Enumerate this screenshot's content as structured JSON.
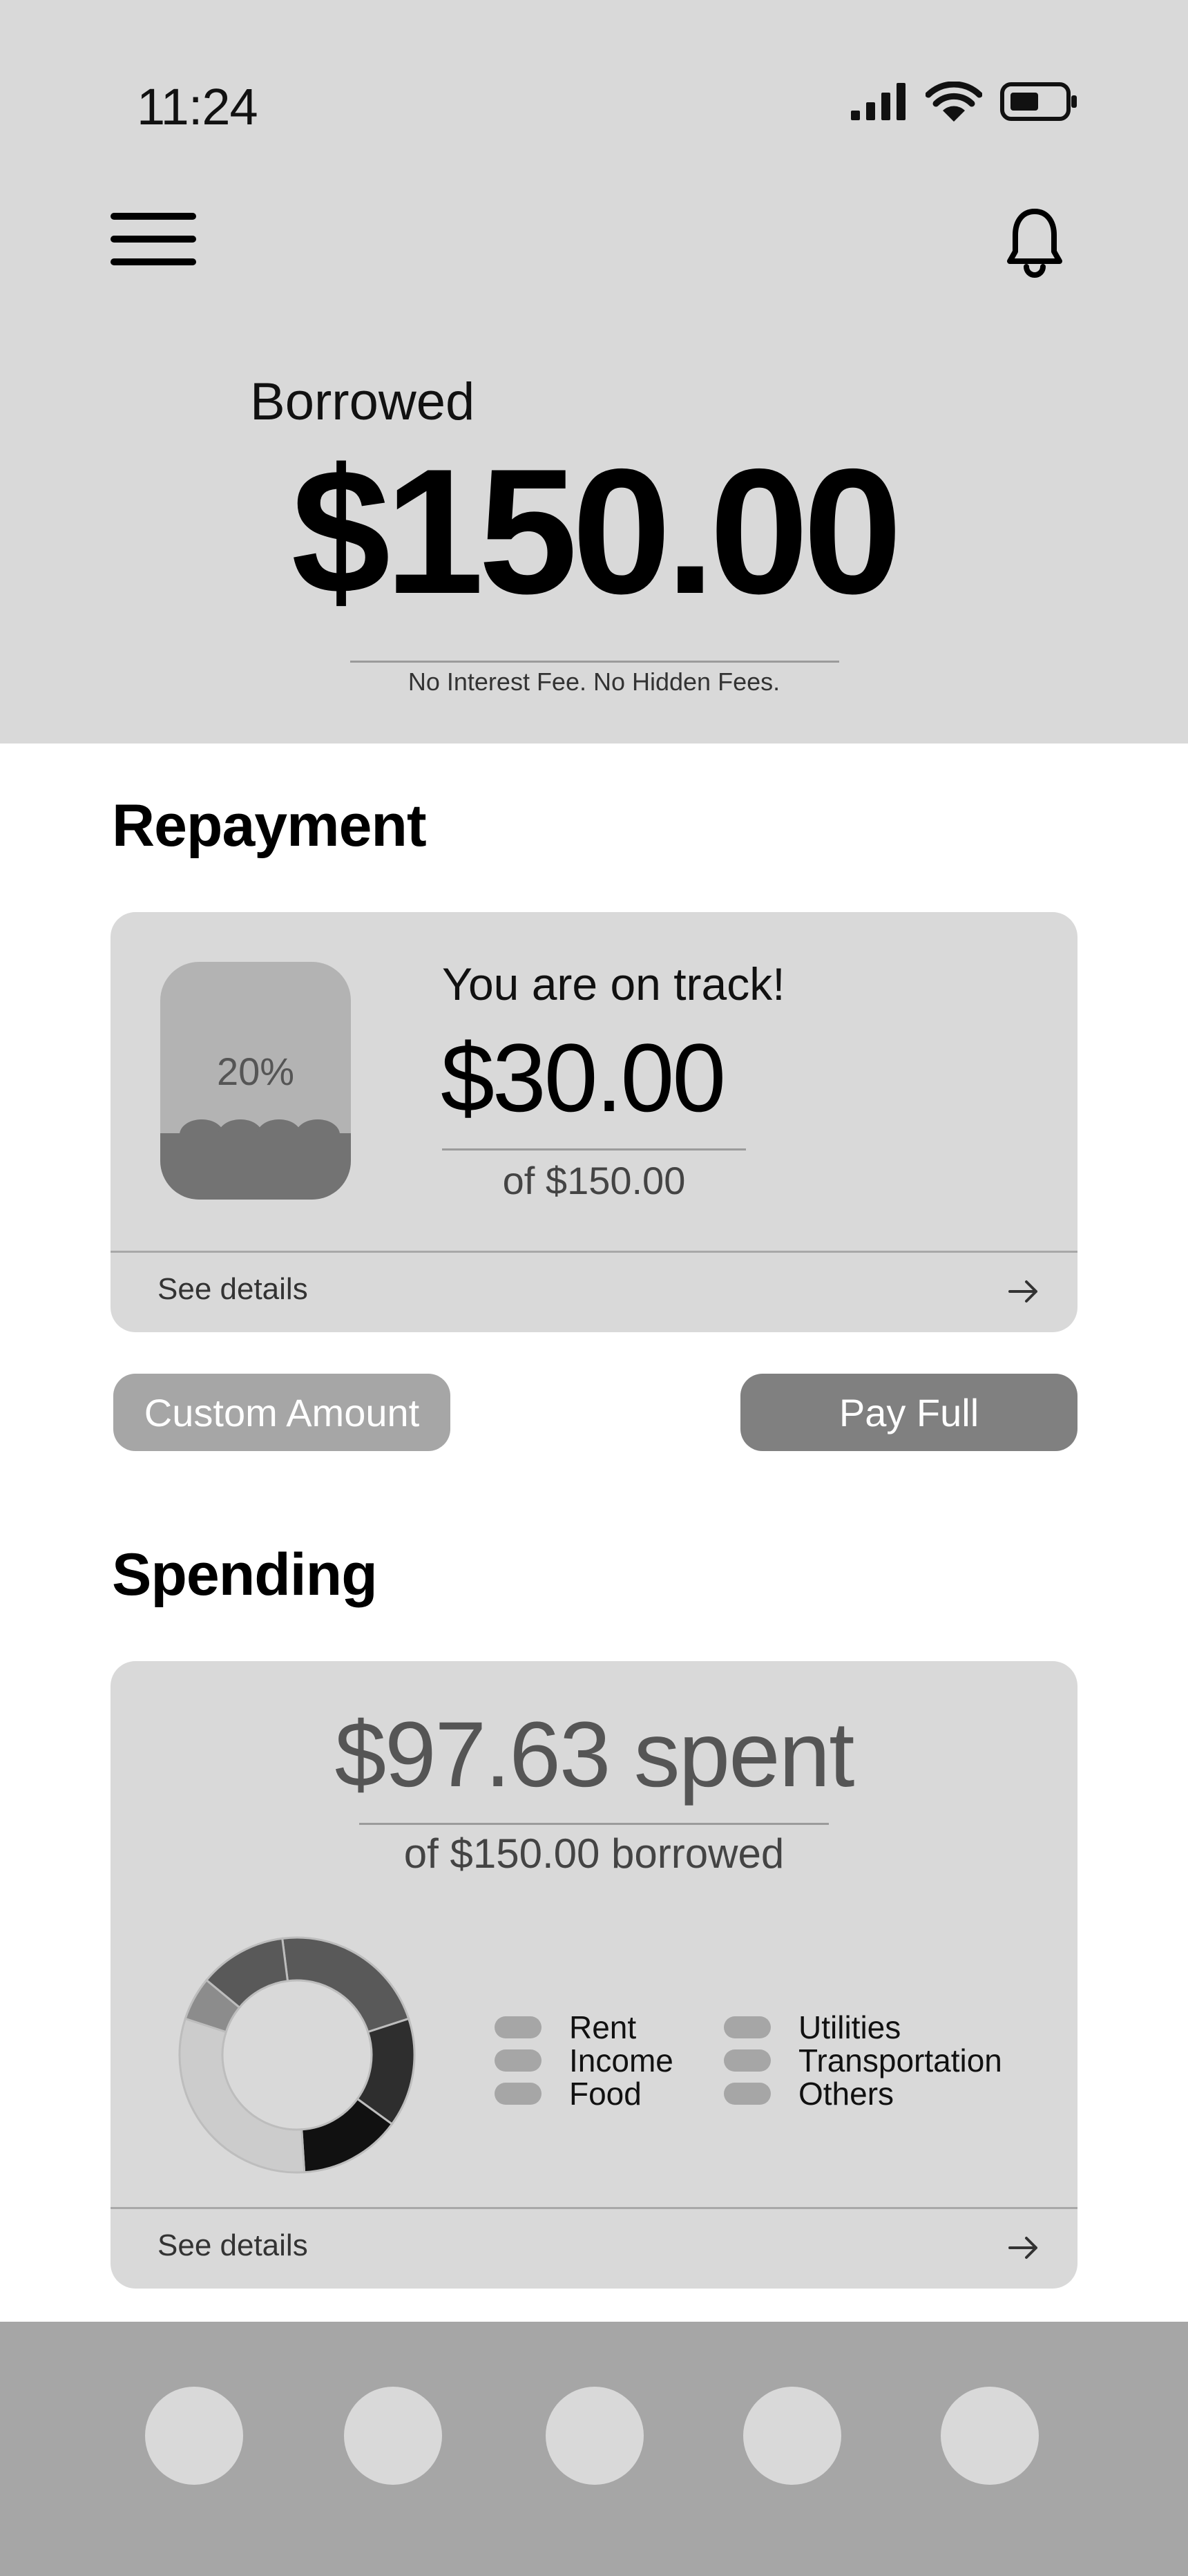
{
  "status_bar": {
    "time": "11:24",
    "icons": [
      "signal-icon",
      "wifi-icon",
      "battery-icon"
    ]
  },
  "header": {
    "menu_icon": "hamburger-menu-icon",
    "notification_icon": "bell-icon"
  },
  "borrowed": {
    "label": "Borrowed",
    "amount": "$150.00",
    "note": "No Interest Fee. No Hidden Fees."
  },
  "repayment": {
    "title": "Repayment",
    "progress_percent": 20,
    "progress_label": "20%",
    "message": "You are on track!",
    "paid_amount": "$30.00",
    "of_total": "of $150.00",
    "see_details": "See details"
  },
  "actions": {
    "custom_amount": "Custom Amount",
    "pay_full": "Pay Full"
  },
  "spending": {
    "title": "Spending",
    "spent": "$97.63 spent",
    "of_borrowed": "of $150.00 borrowed",
    "legend": [
      {
        "label": "Rent"
      },
      {
        "label": "Income"
      },
      {
        "label": "Food"
      },
      {
        "label": "Utilities"
      },
      {
        "label": "Transportation"
      },
      {
        "label": "Others"
      }
    ],
    "see_details": "See details"
  },
  "chart_data": {
    "type": "pie",
    "donut": true,
    "slices": [
      {
        "share": 0.22,
        "color": "#595959"
      },
      {
        "share": 0.15,
        "color": "#2e2e2e"
      },
      {
        "share": 0.14,
        "color": "#111111"
      },
      {
        "share": 0.31,
        "color": "#cccccc"
      },
      {
        "share": 0.06,
        "color": "#8c8c8c"
      },
      {
        "share": 0.12,
        "color": "#595959"
      }
    ]
  },
  "colors": {
    "hero_bg": "#d9d9d9",
    "card_bg": "#d9d9d9",
    "button_light": "#a6a6a6",
    "button_dark": "#808080",
    "nav_bg": "#a6a6a6"
  },
  "bottom_nav": {
    "items": [
      "nav-item-1",
      "nav-item-2",
      "nav-item-3",
      "nav-item-4",
      "nav-item-5"
    ]
  }
}
